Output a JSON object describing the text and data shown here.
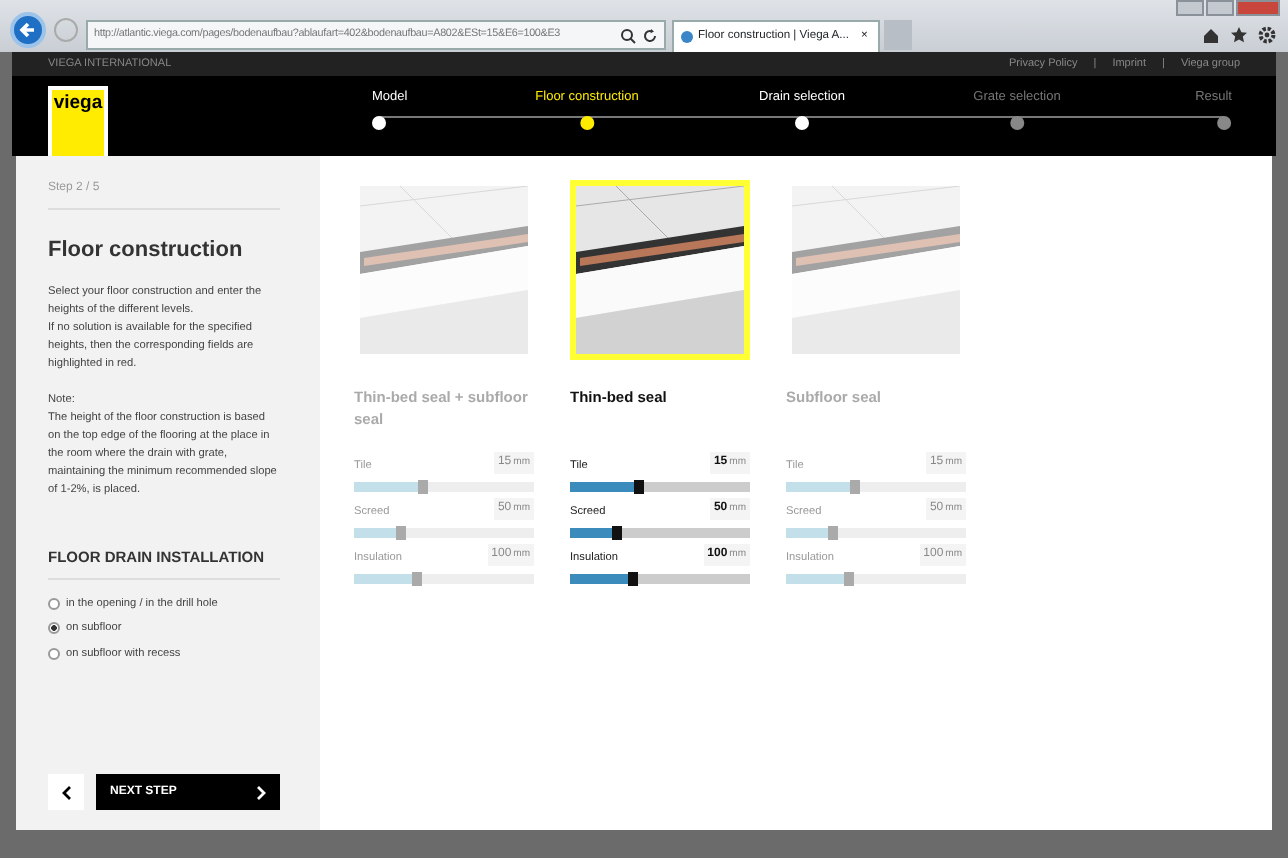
{
  "browser": {
    "url": "http://atlantic.viega.com/pages/bodenaufbau?ablaufart=402&bodenaufbau=A802&ESt=15&E6=100&E3",
    "tab_title": "Floor construction | Viega A...",
    "tab_close": "×"
  },
  "top_bar": {
    "brand": "VIEGA INTERNATIONAL",
    "links": [
      "Privacy Policy",
      "Imprint",
      "Viega group"
    ],
    "separators": [
      "|",
      "|"
    ]
  },
  "logo": "viega",
  "steps": [
    {
      "label": "Model",
      "selected": false,
      "enabled": true
    },
    {
      "label": "Floor construction",
      "selected": true,
      "enabled": true
    },
    {
      "label": "Drain selection",
      "selected": false,
      "enabled": true
    },
    {
      "label": "Grate selection",
      "selected": false,
      "enabled": false
    },
    {
      "label": "Result",
      "selected": false,
      "enabled": false
    }
  ],
  "sidebar": {
    "step": "Step 2 / 5",
    "title": "Floor construction",
    "intro": [
      "Select your floor construction and enter the heights of the different levels.",
      "If no solution is available for the specified heights, then the corresponding fields are highlighted in red."
    ],
    "note_label": "Note:",
    "note": "The height of the floor construction is based on the top edge of the flooring at the place in the room where the drain with grate, maintaining the minimum recommended slope of 1-2%, is placed.",
    "section_title": "FLOOR DRAIN INSTALLATION",
    "options": [
      {
        "label": "in the opening / in the drill hole",
        "selected": false
      },
      {
        "label": "on subfloor",
        "selected": true
      },
      {
        "label": "on subfloor with recess",
        "selected": false
      }
    ],
    "next_button": "NEXT STEP"
  },
  "cards": [
    {
      "title": "Thin-bed seal + subfloor seal",
      "selected": false,
      "fields": [
        {
          "label": "Tile",
          "value": "15",
          "unit": "mm",
          "level": 0.38
        },
        {
          "label": "Screed",
          "value": "50",
          "unit": "mm",
          "level": 0.26
        },
        {
          "label": "Insulation",
          "value": "100",
          "unit": "mm",
          "level": 0.34
        }
      ]
    },
    {
      "title": "Thin-bed seal",
      "selected": true,
      "fields": [
        {
          "label": "Tile",
          "value": "15",
          "unit": "mm",
          "level": 0.38
        },
        {
          "label": "Screed",
          "value": "50",
          "unit": "mm",
          "level": 0.26
        },
        {
          "label": "Insulation",
          "value": "100",
          "unit": "mm",
          "level": 0.34
        }
      ]
    },
    {
      "title": "Subfloor seal",
      "selected": false,
      "fields": [
        {
          "label": "Tile",
          "value": "15",
          "unit": "mm",
          "level": 0.38
        },
        {
          "label": "Screed",
          "value": "50",
          "unit": "mm",
          "level": 0.26
        },
        {
          "label": "Insulation",
          "value": "100",
          "unit": "mm",
          "level": 0.34
        }
      ]
    }
  ]
}
